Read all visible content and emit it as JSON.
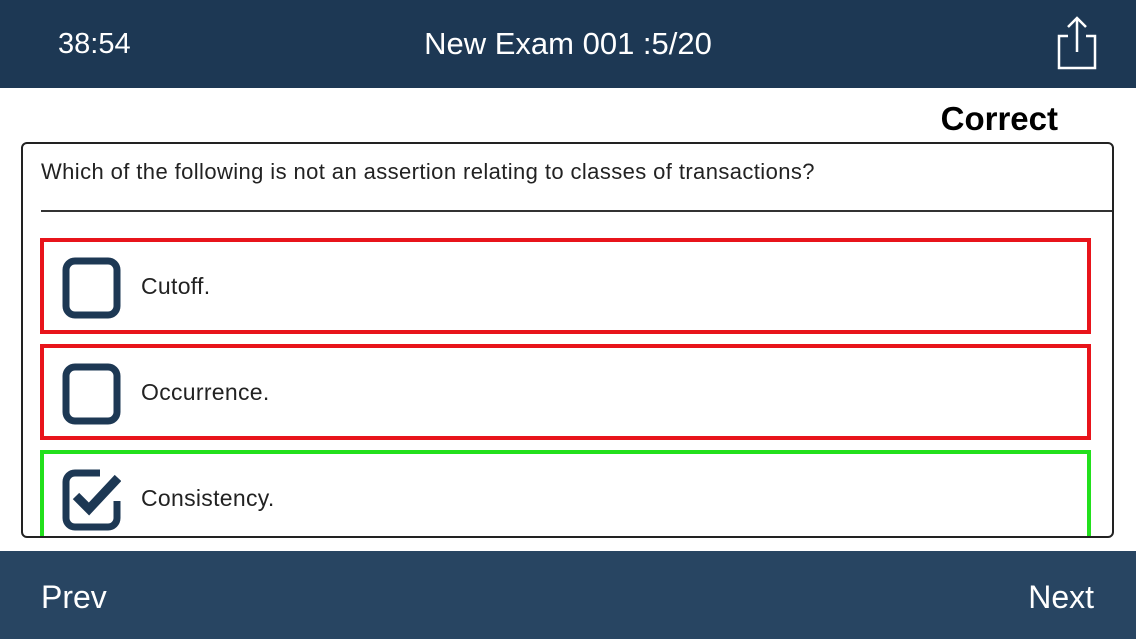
{
  "header": {
    "timer": "38:54",
    "title": "New Exam 001 :5/20",
    "share_icon": "share-icon"
  },
  "result": {
    "status": "Correct"
  },
  "question": {
    "text": "Which of the following is not an assertion relating to classes of transactions?",
    "options": [
      {
        "label": "Cutoff.",
        "checked": false,
        "state": "incorrect"
      },
      {
        "label": "Occurrence.",
        "checked": false,
        "state": "incorrect"
      },
      {
        "label": "Consistency.",
        "checked": true,
        "state": "correct"
      }
    ]
  },
  "footer": {
    "prev_label": "Prev",
    "next_label": "Next"
  },
  "colors": {
    "header_bg": "#1d3854",
    "footer_bg": "#284562",
    "incorrect_border": "#e8141b",
    "correct_border": "#22e01c",
    "checkbox": "#1d3854"
  }
}
